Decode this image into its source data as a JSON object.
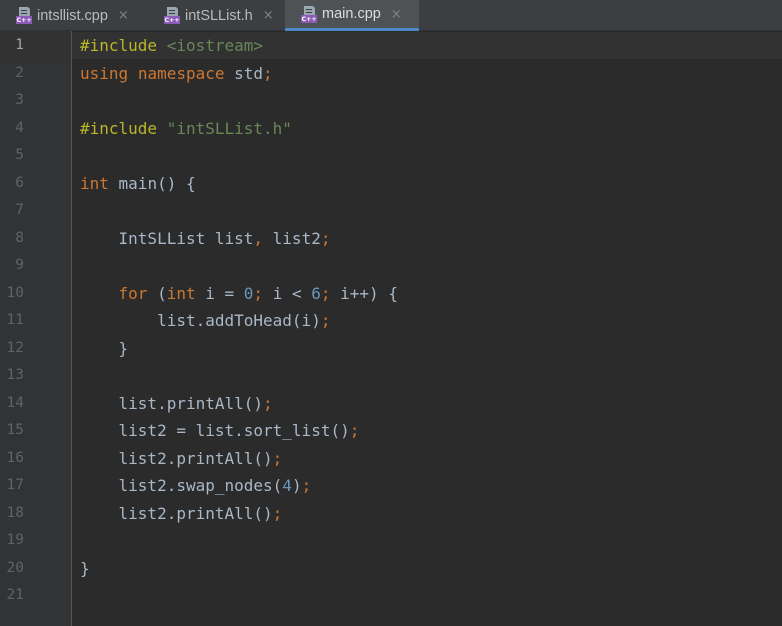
{
  "tabs": [
    {
      "name": "intsllist.cpp",
      "icon": "cpp-file-icon",
      "badge": "C++",
      "active": false
    },
    {
      "name": "intSLList.h",
      "icon": "cpp-file-icon",
      "badge": "C++",
      "active": false
    },
    {
      "name": "main.cpp",
      "icon": "cpp-file-icon",
      "badge": "C++",
      "active": true
    }
  ],
  "close_glyph": "×",
  "editor": {
    "current_line": 1,
    "line_numbers": [
      "1",
      "2",
      "3",
      "4",
      "5",
      "6",
      "7",
      "8",
      "9",
      "10",
      "11",
      "12",
      "13",
      "14",
      "15",
      "16",
      "17",
      "18",
      "19",
      "20",
      "21"
    ],
    "lines": [
      [
        {
          "t": "#include ",
          "c": "pp"
        },
        {
          "t": "<iostream>",
          "c": "str"
        }
      ],
      [
        {
          "t": "using",
          "c": "kw"
        },
        {
          "t": " ",
          "c": ""
        },
        {
          "t": "namespace",
          "c": "kw"
        },
        {
          "t": " std",
          "c": ""
        },
        {
          "t": ";",
          "c": "kw"
        }
      ],
      [],
      [
        {
          "t": "#include ",
          "c": "pp"
        },
        {
          "t": "\"intSLList.h\"",
          "c": "str"
        }
      ],
      [],
      [
        {
          "t": "int",
          "c": "kw"
        },
        {
          "t": " main() {",
          "c": ""
        }
      ],
      [],
      [
        {
          "t": "    IntSLList list",
          "c": ""
        },
        {
          "t": ",",
          "c": "kw"
        },
        {
          "t": " list2",
          "c": ""
        },
        {
          "t": ";",
          "c": "kw"
        }
      ],
      [],
      [
        {
          "t": "    ",
          "c": ""
        },
        {
          "t": "for",
          "c": "kw"
        },
        {
          "t": " (",
          "c": ""
        },
        {
          "t": "int",
          "c": "kw"
        },
        {
          "t": " i = ",
          "c": ""
        },
        {
          "t": "0",
          "c": "num"
        },
        {
          "t": ";",
          "c": "kw"
        },
        {
          "t": " i < ",
          "c": ""
        },
        {
          "t": "6",
          "c": "num"
        },
        {
          "t": ";",
          "c": "kw"
        },
        {
          "t": " i++) {",
          "c": ""
        }
      ],
      [
        {
          "t": "        list.addToHead(i)",
          "c": ""
        },
        {
          "t": ";",
          "c": "kw"
        }
      ],
      [
        {
          "t": "    }",
          "c": ""
        }
      ],
      [],
      [
        {
          "t": "    list.printAll()",
          "c": ""
        },
        {
          "t": ";",
          "c": "kw"
        }
      ],
      [
        {
          "t": "    list2 = list.sort_list()",
          "c": ""
        },
        {
          "t": ";",
          "c": "kw"
        }
      ],
      [
        {
          "t": "    list2.printAll()",
          "c": ""
        },
        {
          "t": ";",
          "c": "kw"
        }
      ],
      [
        {
          "t": "    list2.swap_nodes(",
          "c": ""
        },
        {
          "t": "4",
          "c": "num"
        },
        {
          "t": ")",
          "c": ""
        },
        {
          "t": ";",
          "c": "kw"
        }
      ],
      [
        {
          "t": "    list2.printAll()",
          "c": ""
        },
        {
          "t": ";",
          "c": "kw"
        }
      ],
      [],
      [
        {
          "t": "}",
          "c": ""
        }
      ],
      []
    ]
  },
  "colors": {
    "background": "#2b2b2b",
    "gutter": "#313335",
    "tabbar": "#3c3f41",
    "active_tab": "#4e5254",
    "active_tab_underline": "#4a88c7",
    "keyword": "#cc7832",
    "preprocessor": "#bbb529",
    "string": "#6a8759",
    "number": "#6897bb",
    "identifier": "#a9b7c6",
    "line_number": "#606366",
    "cpp_badge": "#8c5bb8"
  }
}
